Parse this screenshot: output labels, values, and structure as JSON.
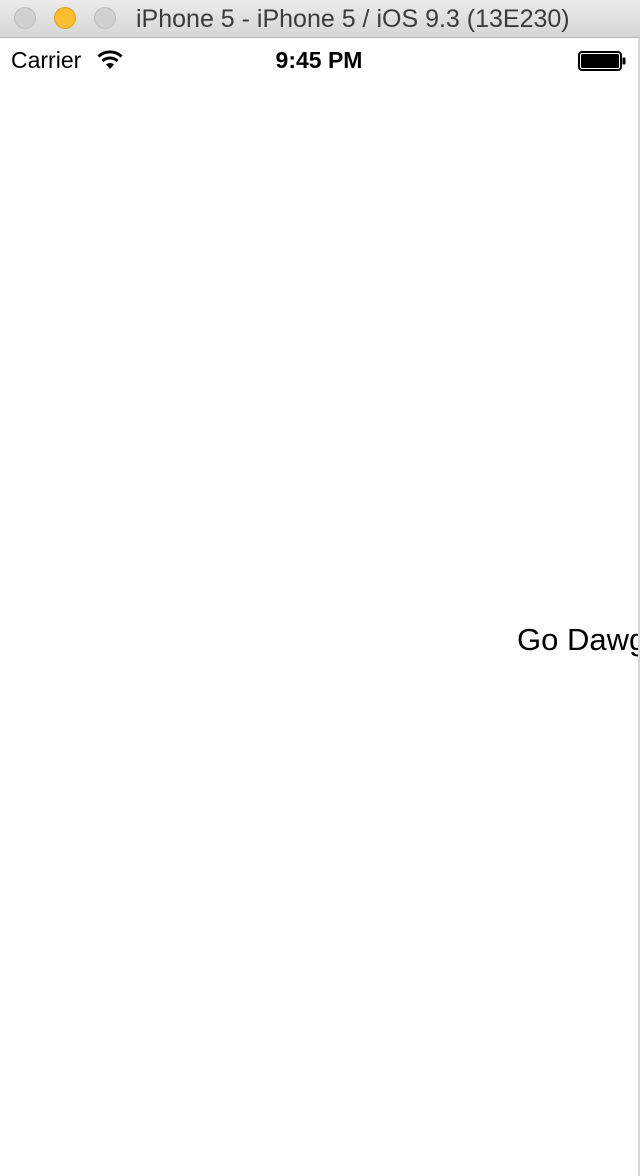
{
  "window": {
    "title": "iPhone 5 - iPhone 5 / iOS 9.3 (13E230)"
  },
  "status_bar": {
    "carrier": "Carrier",
    "time": "9:45 PM",
    "wifi_icon": "wifi-icon",
    "battery_icon": "battery-icon",
    "battery_level": 1.0
  },
  "app": {
    "label": "Go Dawgs"
  },
  "colors": {
    "minimize": "#f9bd2f",
    "inactive_button": "#d0d0d0",
    "background": "#ffffff"
  }
}
